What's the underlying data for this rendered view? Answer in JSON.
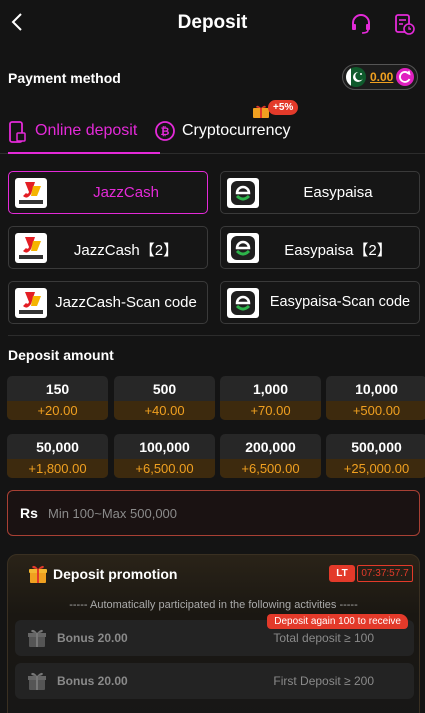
{
  "header": {
    "title": "Deposit",
    "back_icon": "back-icon",
    "support_icon": "headset-icon",
    "history_icon": "record-icon",
    "accent": "#e42ad8"
  },
  "payment": {
    "title": "Payment method",
    "balance": "0.00"
  },
  "tabs": [
    {
      "label": "Online deposit",
      "icon": "phone-icon",
      "active": true
    },
    {
      "label": "Cryptocurrency",
      "icon": "bitcoin-icon",
      "active": false,
      "badge": "+5%"
    }
  ],
  "methods": [
    {
      "name": "JazzCash",
      "logo": "jazzcash-logo",
      "active": true
    },
    {
      "name": "Easypaisa",
      "logo": "easypaisa-logo",
      "active": false
    },
    {
      "name": "JazzCash【2】",
      "logo": "jazzcash-logo",
      "active": false
    },
    {
      "name": "Easypaisa【2】",
      "logo": "easypaisa-logo",
      "active": false
    },
    {
      "name": "JazzCash-Scan code",
      "logo": "jazzcash-logo",
      "active": false
    },
    {
      "name": "Easypaisa-Scan code",
      "logo": "easypaisa-logo",
      "active": false
    }
  ],
  "deposit_amount": {
    "title": "Deposit amount",
    "options": [
      {
        "value": "150",
        "bonus": "+20.00"
      },
      {
        "value": "500",
        "bonus": "+40.00"
      },
      {
        "value": "1,000",
        "bonus": "+70.00"
      },
      {
        "value": "10,000",
        "bonus": "+500.00"
      },
      {
        "value": "50,000",
        "bonus": "+1,800.00"
      },
      {
        "value": "100,000",
        "bonus": "+6,500.00"
      },
      {
        "value": "200,000",
        "bonus": "+6,500.00"
      },
      {
        "value": "500,000",
        "bonus": "+25,000.00"
      }
    ],
    "currency_symbol": "Rs",
    "placeholder": "Min 100~Max 500,000"
  },
  "promotion": {
    "title": "Deposit promotion",
    "lt_label": "LT",
    "timer": "07:37:57.7",
    "auto_text": "----- Automatically participated in the following activities -----",
    "items": [
      {
        "name": "Bonus 20.00",
        "condition": "Total deposit ≥ 100",
        "tip": "Deposit again 100 to receive"
      },
      {
        "name": "Bonus 20.00",
        "condition": "First Deposit ≥ 200",
        "tip": ""
      }
    ]
  }
}
